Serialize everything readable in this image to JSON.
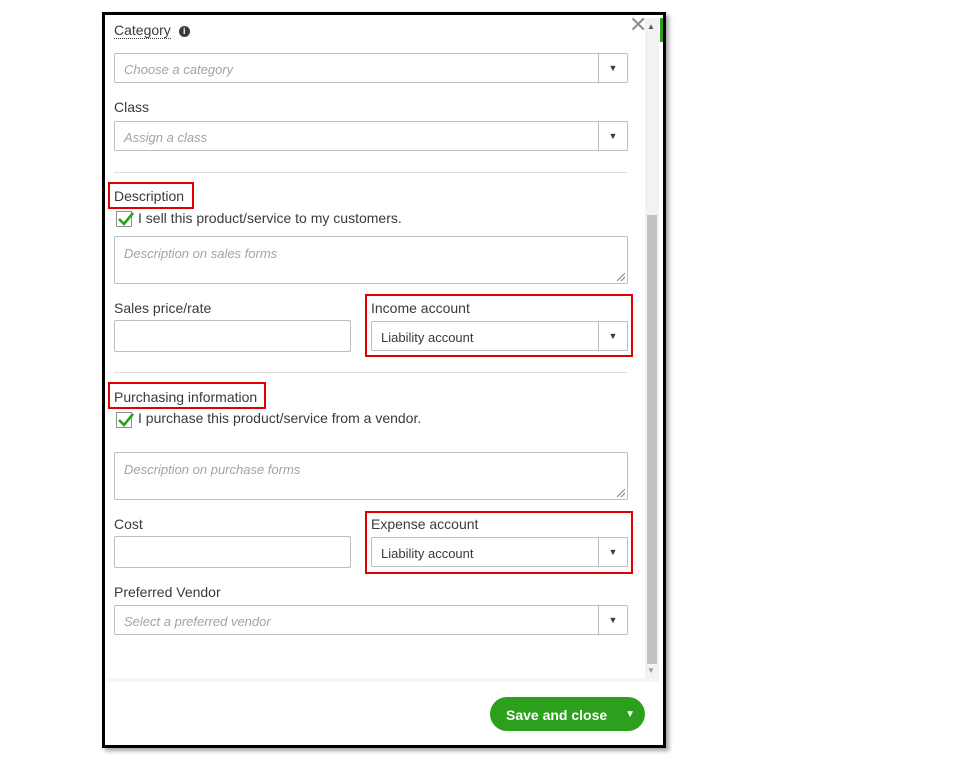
{
  "close_glyph": "✕",
  "category": {
    "label": "Category",
    "info_glyph": "i",
    "placeholder": "Choose a category"
  },
  "class": {
    "label": "Class",
    "placeholder": "Assign a class"
  },
  "sales": {
    "heading": "Description",
    "checkbox_label": "I sell this product/service to my customers.",
    "checked": true,
    "description_placeholder": "Description on sales forms",
    "price_label": "Sales price/rate",
    "price_value": "",
    "income_account_label": "Income account",
    "income_account_value": "Liability account"
  },
  "purchasing": {
    "heading": "Purchasing information",
    "checkbox_label": "I purchase this product/service from a vendor.",
    "checked": true,
    "description_placeholder": "Description on purchase forms",
    "cost_label": "Cost",
    "cost_value": "",
    "expense_account_label": "Expense account",
    "expense_account_value": "Liability account"
  },
  "vendor": {
    "label": "Preferred Vendor",
    "placeholder": "Select a preferred vendor"
  },
  "footer": {
    "save_label": "Save and close"
  },
  "icons": {
    "caret": "chevron-down-icon",
    "check": "checkmark-icon"
  },
  "colors": {
    "accent_green": "#2ca01c",
    "highlight_red": "#e00000"
  }
}
